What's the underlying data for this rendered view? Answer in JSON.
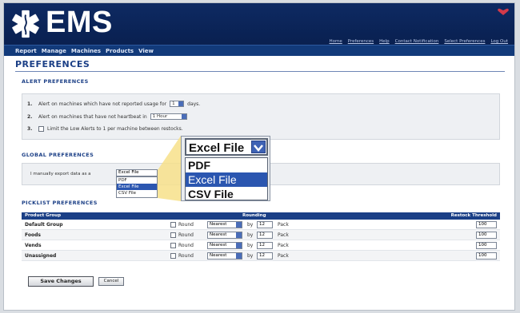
{
  "app": {
    "name": "EMS"
  },
  "top_links": [
    "Home",
    "Preferences",
    "Help",
    "Contact Notification",
    "Select Preferences",
    "Log Out"
  ],
  "menu": [
    "Report",
    "Manage",
    "Machines",
    "Products",
    "View"
  ],
  "page": {
    "title": "PREFERENCES"
  },
  "alert": {
    "heading": "ALERT PREFERENCES",
    "rows": [
      {
        "num": "1.",
        "before": "Alert on machines which have not reported usage for",
        "select": "1",
        "after": "days."
      },
      {
        "num": "2.",
        "before": "Alert on machines that have not heartbeat in",
        "select": "1 Hour"
      },
      {
        "num": "3.",
        "text": "Limit the Low Alerts to 1 per machine between restocks."
      }
    ]
  },
  "global": {
    "heading": "GLOBAL PREFERENCES",
    "text": "I manually export data as a",
    "export_select": "Excel File",
    "export_options": [
      "PDF",
      "Excel File",
      "CSV File"
    ]
  },
  "zoom": {
    "selected": "Excel File",
    "options": [
      "PDF",
      "Excel File",
      "CSV File"
    ]
  },
  "picklist": {
    "heading": "PICKLIST PREFERENCES",
    "columns": {
      "group": "Product Group",
      "rounding": "Rounding",
      "threshold": "Restock Threshold"
    },
    "rows": [
      {
        "group": "Default Group",
        "round_label": "Round",
        "mode": "Nearest",
        "by": "by",
        "amount": "12",
        "unit": "Pack",
        "threshold": "100"
      },
      {
        "group": "Foods",
        "round_label": "Round",
        "mode": "Nearest",
        "by": "by",
        "amount": "12",
        "unit": "Pack",
        "threshold": "100"
      },
      {
        "group": "Vends",
        "round_label": "Round",
        "mode": "Nearest",
        "by": "by",
        "amount": "12",
        "unit": "Pack",
        "threshold": "100"
      },
      {
        "group": "Unassigned",
        "round_label": "Round",
        "mode": "Nearest",
        "by": "by",
        "amount": "12",
        "unit": "Pack",
        "threshold": "100"
      }
    ]
  },
  "buttons": {
    "save": "Save Changes",
    "cancel": "Cancel"
  },
  "colors": {
    "header": "#0a2254",
    "menubar": "#123a7a",
    "accent": "#1b3f86",
    "selection": "#2b56b0"
  },
  "icons": {
    "logo": "star-of-life-icon",
    "dropdown": "chevron-down-icon"
  }
}
